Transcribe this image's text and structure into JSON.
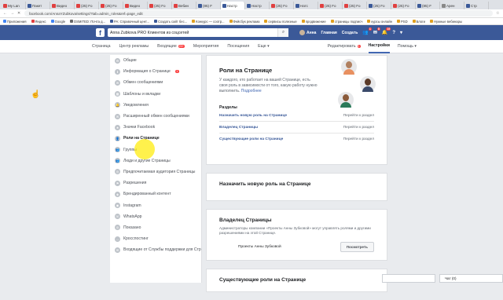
{
  "browser": {
    "tabs": [
      {
        "label": "My Lan",
        "color": "#e04040"
      },
      {
        "label": "Пакет",
        "color": "#3b5998"
      },
      {
        "label": "Видео",
        "color": "#e04040"
      },
      {
        "label": "(25) Fo",
        "color": "#e04040"
      },
      {
        "label": "(25) Fo",
        "color": "#e04040"
      },
      {
        "label": "Видео",
        "color": "#e04040"
      },
      {
        "label": "(25) Fo",
        "color": "#e04040"
      },
      {
        "label": "Вебин",
        "color": "#e04040"
      },
      {
        "label": "(85) F",
        "color": "#3b5998"
      },
      {
        "label": "Настр",
        "color": "#3b5998",
        "active": true
      },
      {
        "label": "Настр",
        "color": "#3b5998"
      },
      {
        "label": "(25) Fo",
        "color": "#e04040"
      },
      {
        "label": "Натс",
        "color": "#3b5998"
      },
      {
        "label": "(25) Fo",
        "color": "#e04040"
      },
      {
        "label": "(25) Fo",
        "color": "#e04040"
      },
      {
        "label": "(25) Fo",
        "color": "#3b5998"
      },
      {
        "label": "(25) Fo",
        "color": "#e04040"
      },
      {
        "label": "(85) F",
        "color": "#3b5998"
      },
      {
        "label": "Арен",
        "color": "#888888"
      },
      {
        "label": "Стр",
        "color": "#3b5998"
      }
    ],
    "url": "facebook.com/AnnaYZubkova/settings/?tab=admin_roles&ref=page_edit",
    "bookmarks": [
      {
        "label": "Приложения",
        "color": "#4285f4"
      },
      {
        "label": "Яндекс",
        "color": "#e04040"
      },
      {
        "label": "Google",
        "color": "#4285f4"
      },
      {
        "label": "DSMITED: Почта д...",
        "color": "#666666"
      },
      {
        "label": "РА: Справочный цент...",
        "color": "#3b5998"
      },
      {
        "label": "Создать сайт бес...",
        "color": "#3b5998"
      },
      {
        "label": "Конкурс — соотр...",
        "color": "#e0a020"
      },
      {
        "label": "Фейсбук реклама",
        "color": "#e0a020"
      },
      {
        "label": "сервисы полезные",
        "color": "#e0a020"
      },
      {
        "label": "продвижение",
        "color": "#e0a020"
      },
      {
        "label": "страницы подписч",
        "color": "#e0a020"
      },
      {
        "label": "курсы онлайн",
        "color": "#e0a020"
      },
      {
        "label": "PSD",
        "color": "#e0a020"
      },
      {
        "label": "Блоги",
        "color": "#e0a020"
      },
      {
        "label": "Нужные вебинары",
        "color": "#e0a020"
      }
    ]
  },
  "fb": {
    "search_value": "Anna Zubkova PRO Клиентов из соцсетей",
    "user_name": "Анна",
    "home": "Главная",
    "create": "Создать",
    "friends_badge": "1",
    "msg_badge": "8",
    "notif_badge": "19"
  },
  "pagenav": {
    "left": [
      {
        "label": "Страница"
      },
      {
        "label": "Центр рекламы"
      },
      {
        "label": "Входящие",
        "badge": "20+"
      },
      {
        "label": "Мероприятия"
      },
      {
        "label": "Посещения"
      },
      {
        "label": "Еще ▾"
      }
    ],
    "right": [
      {
        "label": "Редактировать",
        "badge": "1"
      },
      {
        "label": "Настройки",
        "active": true
      },
      {
        "label": "Помощь ▾"
      }
    ]
  },
  "sidebar": {
    "items": [
      {
        "label": "Общие"
      },
      {
        "label": "Информация о Странице",
        "badge": "1"
      },
      {
        "label": "Обмен сообщениями"
      },
      {
        "label": "Шаблоны и вкладки"
      },
      {
        "label": "Уведомления"
      },
      {
        "label": "Расширенный обмен сообщениями"
      },
      {
        "label": "Значки Facebook"
      },
      {
        "label": "Роли на Странице",
        "active": true
      },
      {
        "label": "Группы"
      },
      {
        "label": "Люди и другие Страницы"
      },
      {
        "label": "Предпочитаемая аудитория Страницы"
      },
      {
        "label": "Разрешения"
      },
      {
        "label": "Брендированный контент"
      },
      {
        "label": "Instagram"
      },
      {
        "label": "WhatsApp"
      },
      {
        "label": "Показано"
      },
      {
        "label": "Кросспостинг"
      },
      {
        "label": "Входящие от Службы поддержки для Стр"
      }
    ]
  },
  "roles": {
    "title": "Роли на Странице",
    "desc": "У каждого, кто работает на вашей Странице, есть своя роль в зависимости от того, какую работу нужно выполнить.",
    "more": "Подробнее",
    "sections_label": "Разделы",
    "sections": [
      {
        "label": "Назначить новую роль на Странице",
        "link": "Перейти к раздел"
      },
      {
        "label": "Владелец Страницы",
        "link": "Перейти к раздел"
      },
      {
        "label": "Существующие роли на Странице",
        "link": "Перейти к раздел"
      }
    ]
  },
  "assign": {
    "title": "Назначить новую роль на Странице"
  },
  "owner": {
    "title": "Владелец Страницы",
    "desc": "Администраторы компании «Проекты Анны Зубковой» могут управлять ролями и другими разрешениями на этой Странице.",
    "name": "Проекты Анны Зубковой",
    "button": "Посмотреть"
  },
  "existing": {
    "title": "Существующие роли на Странице"
  },
  "chat": {
    "label": "Чат (0)"
  }
}
